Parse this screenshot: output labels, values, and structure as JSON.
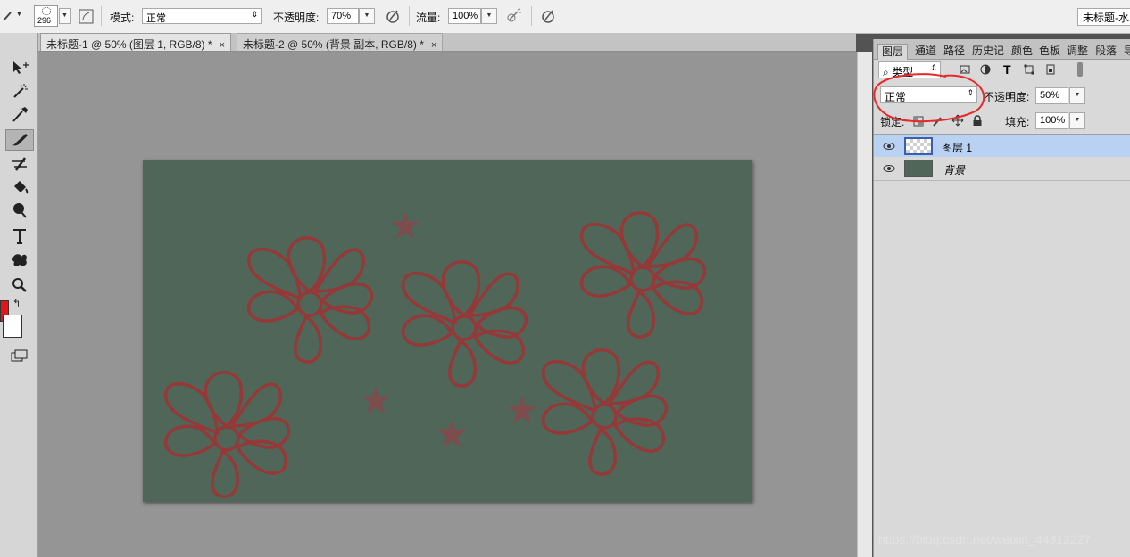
{
  "options_bar": {
    "brush_size": "296",
    "mode_label": "模式:",
    "mode_value": "正常",
    "opacity_label": "不透明度:",
    "opacity_value": "70%",
    "flow_label": "流量:",
    "flow_value": "100%",
    "right_button_label": "未标题-水"
  },
  "tabs": [
    {
      "label": "未标题-1 @ 50% (图层 1, RGB/8) *",
      "close": "×"
    },
    {
      "label": "未标题-2 @ 50% (背景 副本, RGB/8) *",
      "close": "×"
    }
  ],
  "colors": {
    "foreground": "#e4141a",
    "background": "#ffffff",
    "canvas_fill": "#4f6659",
    "flower_stroke": "#963838",
    "star_fill": "#7e4c4c",
    "layer_selected": "#b9d1f2",
    "annotation_circle": "#e8282a"
  },
  "layers_panel": {
    "tabs": [
      "图层",
      "通道",
      "路径",
      "历史记",
      "颜色",
      "色板",
      "调整",
      "段落",
      "导"
    ],
    "filter_kind": "类型",
    "blend_mode": "正常",
    "opacity_label": "不透明度:",
    "opacity_value": "50%",
    "lock_label": "锁定:",
    "fill_label": "填充:",
    "fill_value": "100%",
    "layers": [
      {
        "name": "图层 1",
        "selected": true
      },
      {
        "name": "背景",
        "selected": false
      }
    ]
  },
  "watermark": "https://blog.csdn.net/weixin_44312227"
}
